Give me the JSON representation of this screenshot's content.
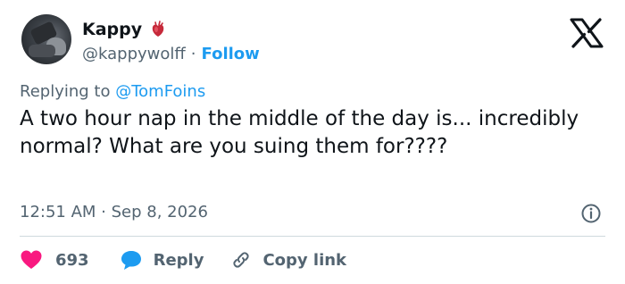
{
  "author": {
    "display_name": "Kappy",
    "handle": "@kappywolff",
    "separator": "·",
    "follow_label": "Follow",
    "name_emoji": "anatomical-heart-icon"
  },
  "brand_icon": "x-logo-icon",
  "reply_context": {
    "prefix": "Replying to",
    "mention": "@TomFoins"
  },
  "tweet": {
    "text": "A two hour nap in the middle of the day is... incredibly normal? What are you suing them for????",
    "timestamp": "12:51 AM · Sep 8, 2026"
  },
  "actions": {
    "likes": "693",
    "reply_label": "Reply",
    "copy_link_label": "Copy link"
  },
  "colors": {
    "accent": "#1d9bf0",
    "like": "#f91880",
    "text": "#0f1419",
    "secondary": "#536471",
    "divider": "#cfd9de"
  }
}
